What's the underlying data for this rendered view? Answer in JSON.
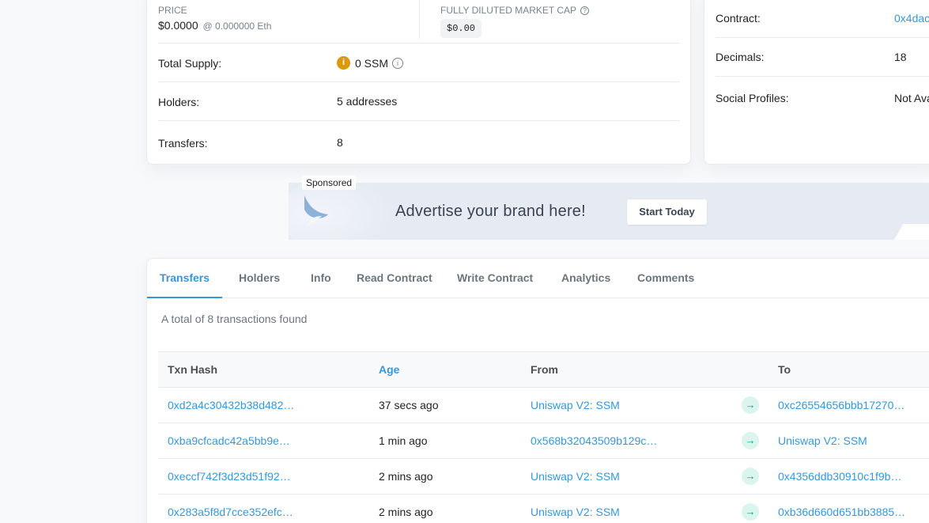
{
  "overview": {
    "price_label": "PRICE",
    "price_value": "$0.0000",
    "price_eth": "@ 0.000000 Eth",
    "mcap_label": "FULLY DILUTED MARKET CAP",
    "mcap_value": "$0.00",
    "rows": [
      {
        "label": "Total Supply:",
        "value": "0 SSM"
      },
      {
        "label": "Holders:",
        "value": "5 addresses"
      },
      {
        "label": "Transfers:",
        "value": "8"
      }
    ]
  },
  "profile": {
    "rows": [
      {
        "label": "Contract:",
        "value": "0x4dac"
      },
      {
        "label": "Decimals:",
        "value": "18"
      },
      {
        "label": "Social Profiles:",
        "value": "Not Ava"
      }
    ]
  },
  "ad": {
    "sponsored": "Sponsored",
    "headline": "Advertise your brand here!",
    "cta": "Start Today"
  },
  "tabs": [
    "Transfers",
    "Holders",
    "Info",
    "Read Contract",
    "Write Contract",
    "Analytics",
    "Comments"
  ],
  "transfers": {
    "summary": "A total of 8 transactions found",
    "columns": [
      "Txn Hash",
      "Age",
      "From",
      "To"
    ],
    "rows": [
      {
        "hash": "0xd2a4c30432b38d482…",
        "age": "37 secs ago",
        "from": "Uniswap V2: SSM",
        "to": "0xc26554656bbb17270…"
      },
      {
        "hash": "0xba9cfcadc42a5bb9e…",
        "age": "1 min ago",
        "from": "0x568b32043509b129c…",
        "to": "Uniswap V2: SSM"
      },
      {
        "hash": "0xeccf742f3d23d51f92…",
        "age": "2 mins ago",
        "from": "Uniswap V2: SSM",
        "to": "0x4356ddb30910c1f9b…"
      },
      {
        "hash": "0x283a5f8d7cce352efc…",
        "age": "2 mins ago",
        "from": "Uniswap V2: SSM",
        "to": "0xb36d660d651bb3885…"
      }
    ]
  }
}
